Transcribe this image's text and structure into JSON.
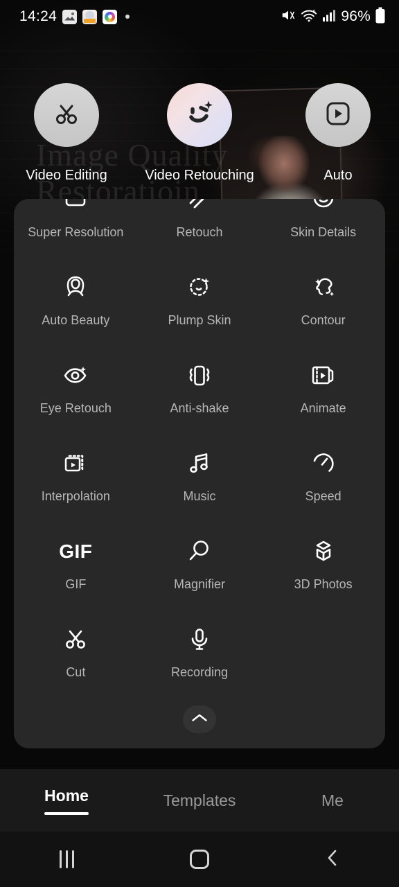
{
  "status_bar": {
    "time": "14:24",
    "notification_icons": [
      "photos-icon",
      "sticker-icon",
      "camera-icon",
      "dot-indicator"
    ],
    "sound_icon": "mute-icon",
    "wifi_icon": "wifi-6-icon",
    "signal_icon": "cellular-signal-icon",
    "battery_percent": "96%",
    "battery_icon": "battery-icon"
  },
  "hero": {
    "title": "Image Quality Restoratioin"
  },
  "quick_actions": [
    {
      "label": "Video Editing",
      "icon": "scissors-icon",
      "style": "grey"
    },
    {
      "label": "Video Retouching",
      "icon": "smiley-sparkle-icon",
      "style": "gradient"
    },
    {
      "label": "Auto",
      "icon": "play-square-icon",
      "style": "grey"
    }
  ],
  "tools": [
    {
      "label": "Super Resolution",
      "icon": "super-resolution-icon"
    },
    {
      "label": "Retouch",
      "icon": "magic-wand-icon"
    },
    {
      "label": "Skin Details",
      "icon": "face-circle-icon"
    },
    {
      "label": "Auto Beauty",
      "icon": "auto-beauty-icon"
    },
    {
      "label": "Plump Skin",
      "icon": "plump-skin-icon"
    },
    {
      "label": "Contour",
      "icon": "contour-icon"
    },
    {
      "label": "Eye Retouch",
      "icon": "eye-sparkle-icon"
    },
    {
      "label": "Anti-shake",
      "icon": "anti-shake-icon"
    },
    {
      "label": "Animate",
      "icon": "film-play-icon"
    },
    {
      "label": "Interpolation",
      "icon": "frame-interpolation-icon"
    },
    {
      "label": "Music",
      "icon": "music-note-icon"
    },
    {
      "label": "Speed",
      "icon": "speedometer-icon"
    },
    {
      "label": "GIF",
      "icon": "gif-text-icon"
    },
    {
      "label": "Magnifier",
      "icon": "magnifier-icon"
    },
    {
      "label": "3D Photos",
      "icon": "cube-3d-icon"
    },
    {
      "label": "Cut",
      "icon": "scissors-icon"
    },
    {
      "label": "Recording",
      "icon": "microphone-icon"
    }
  ],
  "panel": {
    "collapse_icon": "chevron-up-icon"
  },
  "bottom_tabs": [
    {
      "label": "Home",
      "active": true
    },
    {
      "label": "Templates",
      "active": false
    },
    {
      "label": "Me",
      "active": false
    }
  ],
  "nav_bar": {
    "recents_icon": "recents-icon",
    "home_icon": "home-icon",
    "back_icon": "back-icon"
  },
  "colors": {
    "panel_bg": "#282828",
    "page_bg": "#050505",
    "tabbar_bg": "#1a1a1a",
    "accent_text": "#ffffff",
    "muted_text": "#b6b6b6"
  }
}
